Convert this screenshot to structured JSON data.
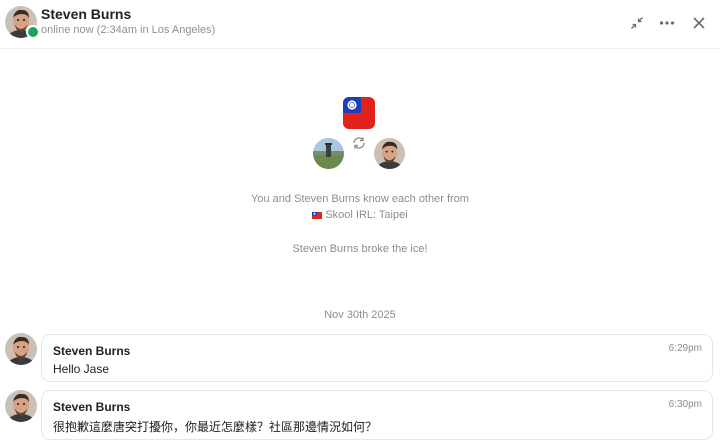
{
  "header": {
    "name": "Steven Burns",
    "status": "online now (2:34am in Los Angeles)",
    "buttons": {
      "collapse": "collapse-icon",
      "more": "more-icon",
      "close": "close-icon"
    }
  },
  "intro": {
    "know_text": "You and Steven Burns know each other from",
    "group": "Skool IRL: Taipei",
    "ice_text": "Steven Burns broke the ice!"
  },
  "date_separator": "Nov 30th 2025",
  "messages": [
    {
      "author": "Steven Burns",
      "time": "6:29pm",
      "text": "Hello Jase"
    },
    {
      "author": "Steven Burns",
      "time": "6:30pm",
      "text": "很抱歉這麼唐突打擾你，你最近怎麼樣？社區那邊情況如何？"
    }
  ],
  "colors": {
    "online": "#1ea35a",
    "muted_text": "#8c8c8c",
    "flag_red": "#e2231a",
    "flag_blue": "#1d3fbd"
  }
}
